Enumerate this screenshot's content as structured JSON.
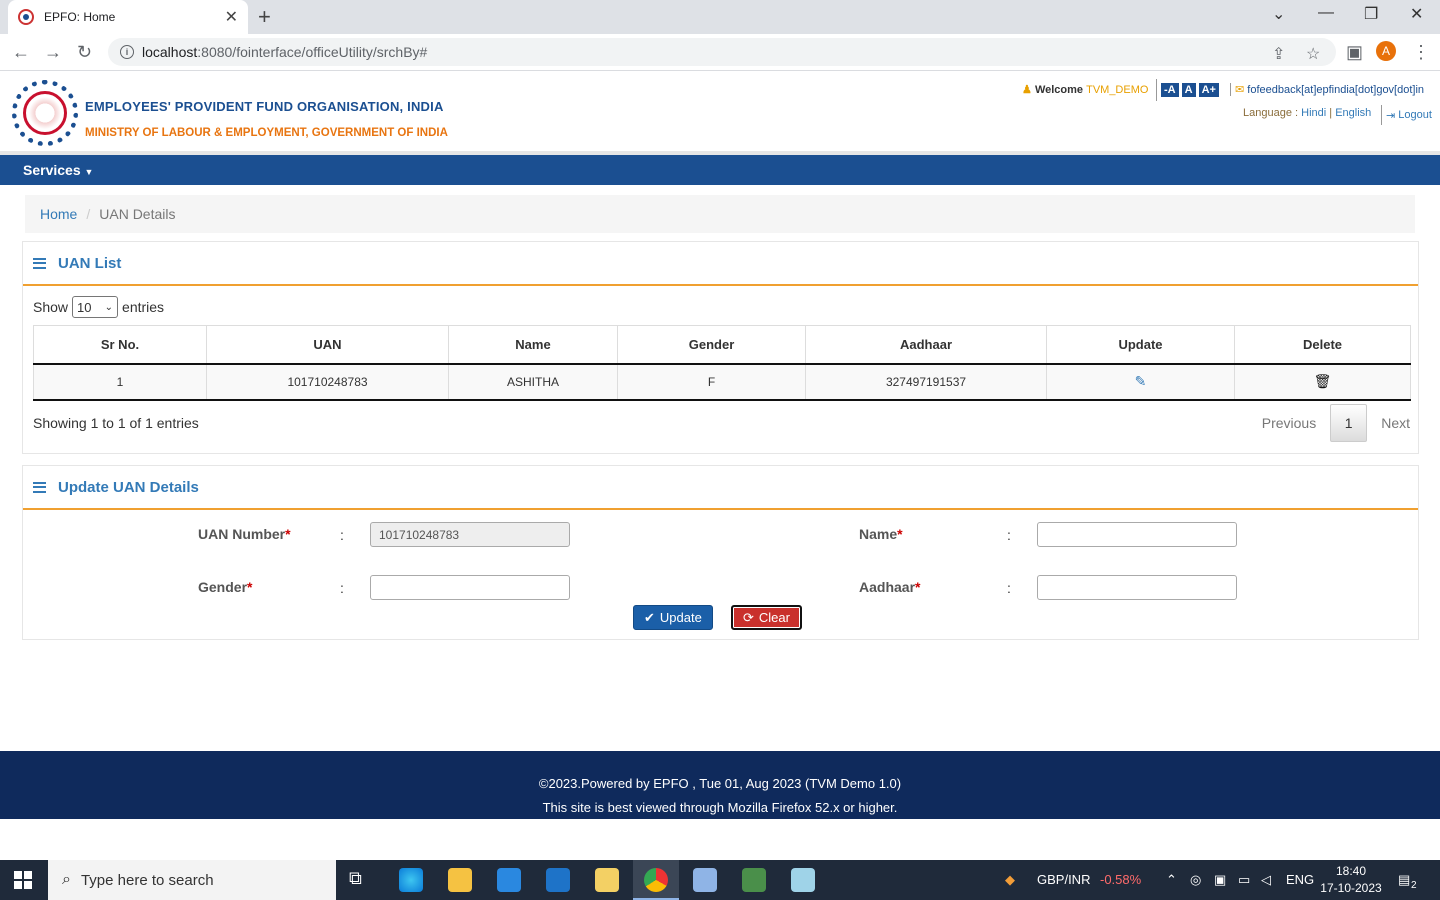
{
  "browser": {
    "tab_title": "EPFO: Home",
    "tab_close": "✕",
    "new_tab": "+",
    "url_host": "localhost",
    "url_path": ":8080/fointerface/officeUtility/srchBy#",
    "profile_initial": "A"
  },
  "header": {
    "org_name": "EMPLOYEES' PROVIDENT FUND ORGANISATION, INDIA",
    "ministry": "MINISTRY OF LABOUR & EMPLOYMENT, GOVERNMENT OF INDIA",
    "welcome_label": "Welcome",
    "username": "TVM_DEMO",
    "font_small": "-A",
    "font_normal": "A",
    "font_large": "A+",
    "feedback_email": "fofeedback[at]epfindia[dot]gov[dot]in",
    "language_label": "Language :",
    "lang_hindi": "Hindi",
    "lang_sep": "|",
    "lang_english": "English",
    "logout": "Logout"
  },
  "nav": {
    "services": "Services"
  },
  "breadcrumb": {
    "home": "Home",
    "sep": "/",
    "current": "UAN Details"
  },
  "uan_list": {
    "title": "UAN List",
    "show_label": "Show",
    "entries_value": "10",
    "entries_label": "entries",
    "columns": [
      "Sr No.",
      "UAN",
      "Name",
      "Gender",
      "Aadhaar",
      "Update",
      "Delete"
    ],
    "rows": [
      {
        "sr": "1",
        "uan": "101710248783",
        "name": "ASHITHA",
        "gender": "F",
        "aadhaar": "327497191537"
      }
    ],
    "showing_text": "Showing 1 to 1 of 1 entries",
    "prev": "Previous",
    "page": "1",
    "next": "Next"
  },
  "update_form": {
    "title": "Update UAN Details",
    "uan_label": "UAN Number",
    "name_label": "Name",
    "gender_label": "Gender",
    "aadhaar_label": "Aadhaar",
    "required_mark": "*",
    "colon": ":",
    "uan_value": "101710248783",
    "name_value": "",
    "gender_value": "",
    "aadhaar_value": "",
    "update_btn": "Update",
    "clear_btn": "Clear"
  },
  "footer": {
    "line1": "©2023.Powered by EPFO , Tue 01, Aug 2023 (TVM Demo 1.0)",
    "line2": "This site is best viewed through Mozilla Firefox 52.x or higher."
  },
  "taskbar": {
    "search_placeholder": "Type here to search",
    "currency": "GBP/INR",
    "currency_change": "-0.58%",
    "lang": "ENG",
    "time": "18:40",
    "date": "17-10-2023",
    "notif_count": "2"
  },
  "colors": {
    "brand_blue": "#1b4f91",
    "brand_orange": "#e87511",
    "footer_bg": "#0f2a5c",
    "clear_red": "#c9302c"
  }
}
